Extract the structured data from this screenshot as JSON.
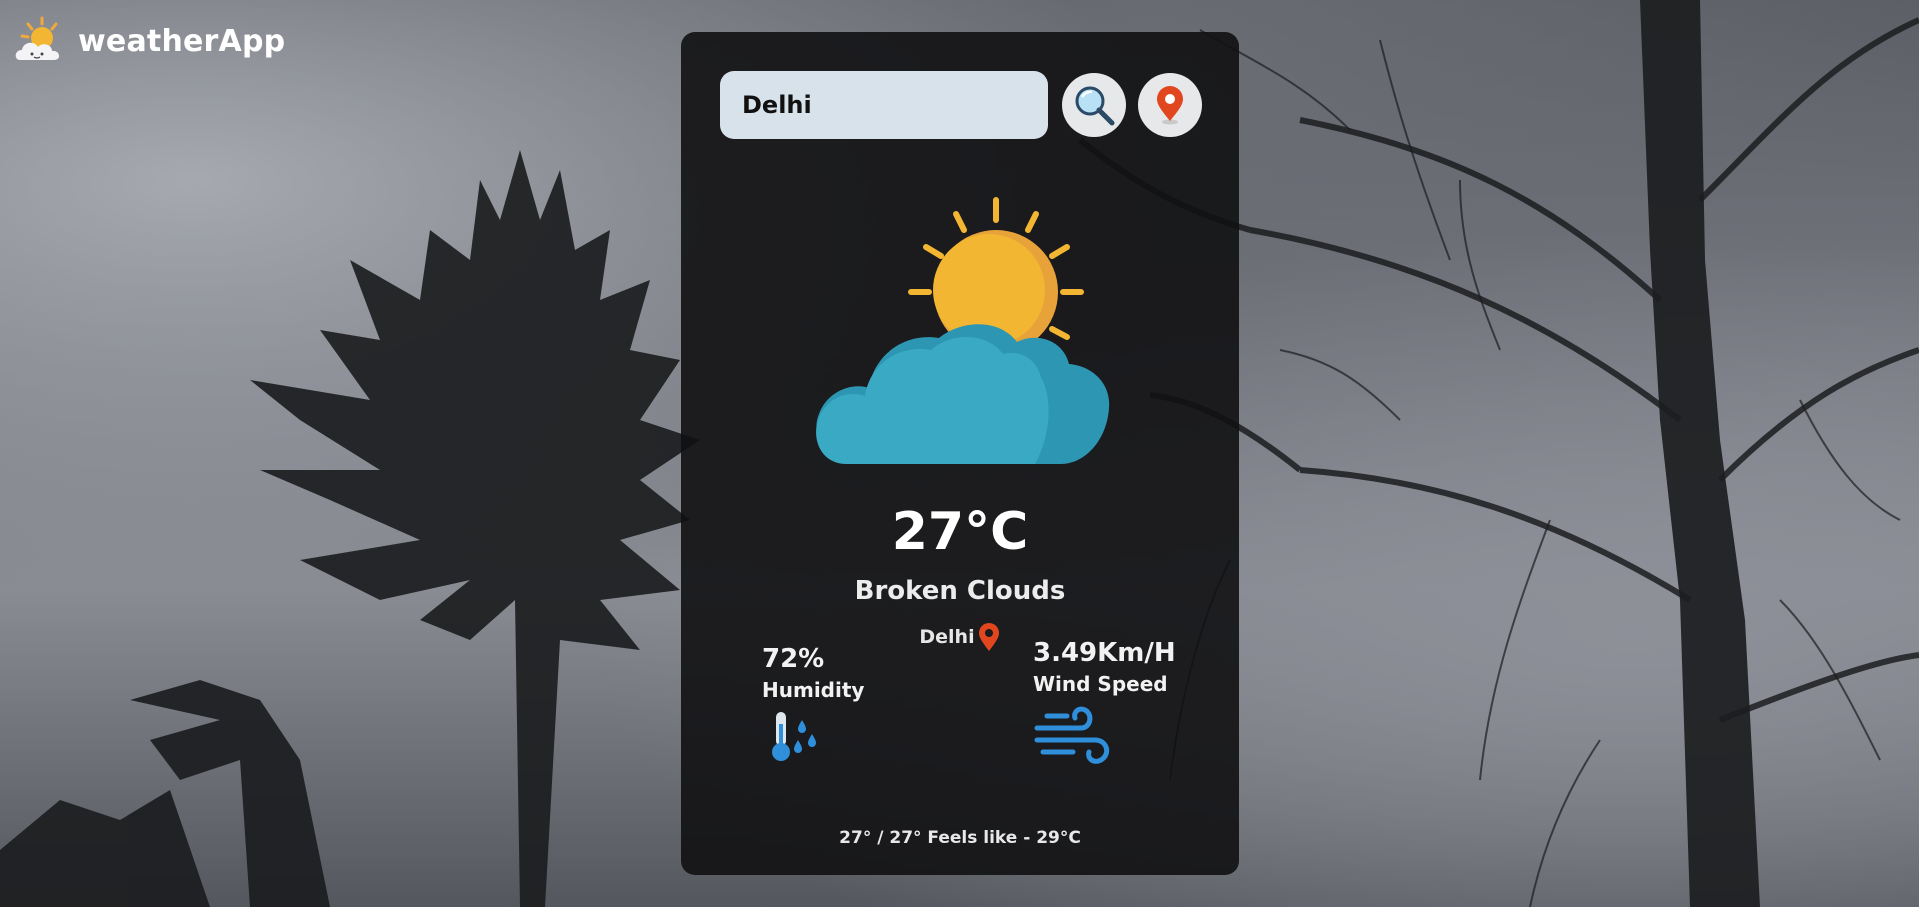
{
  "app": {
    "name": "weatherApp"
  },
  "search": {
    "value": "Delhi"
  },
  "weather": {
    "temperature": "27°C",
    "description": "Broken Clouds",
    "location": "Delhi",
    "icon": "sun-behind-cloud-icon"
  },
  "humidity": {
    "value": "72%",
    "label": "Humidity",
    "icon": "thermometer-drops-icon"
  },
  "wind": {
    "value": "3.49Km/H",
    "label": "Wind Speed",
    "icon": "wind-icon"
  },
  "feels_like": "27° / 27° Feels like - 29°C",
  "colors": {
    "card_bg": "#111113",
    "input_bg": "#d8e2ea",
    "location_pin": "#e2461f",
    "sun": "#f2b632",
    "cloud": "#3aa9c4",
    "icon_blue": "#2f8fdb"
  }
}
